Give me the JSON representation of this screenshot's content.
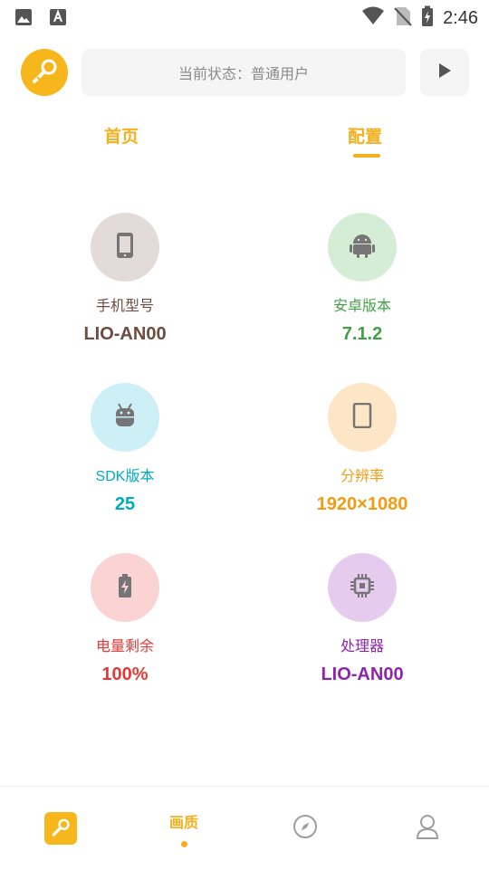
{
  "statusbar": {
    "time": "2:46",
    "icons": [
      "image-icon",
      "font-icon",
      "wifi-icon",
      "no-sim-icon",
      "battery-charging-icon"
    ]
  },
  "header": {
    "status_text": "当前状态：普通用户"
  },
  "tabs": [
    {
      "label": "首页",
      "active": false
    },
    {
      "label": "配置",
      "active": true
    }
  ],
  "info_cards": [
    {
      "label": "手机型号",
      "value": "LIO-AN00",
      "icon": "phone-icon",
      "color": "#6d4c41",
      "bg": "#e3dbd8"
    },
    {
      "label": "安卓版本",
      "value": "7.1.2",
      "icon": "android-icon",
      "color": "#43a047",
      "bg": "#d5ecd5"
    },
    {
      "label": "SDK版本",
      "value": "25",
      "icon": "android-head-icon",
      "color": "#00acc1",
      "bg": "#cdeff6"
    },
    {
      "label": "分辨率",
      "value": "1920×1080",
      "icon": "tablet-icon",
      "color": "#f39c12",
      "bg": "#fde6c6"
    },
    {
      "label": "电量剩余",
      "value": "100%",
      "icon": "battery-icon",
      "color": "#e53935",
      "bg": "#fbd3d3"
    },
    {
      "label": "处理器",
      "value": "LIO-AN00",
      "icon": "cpu-icon",
      "color": "#8e24aa",
      "bg": "#e5cbee"
    }
  ],
  "bottom_nav": [
    {
      "icon": "app-logo-icon",
      "label": ""
    },
    {
      "icon": "",
      "label": "画质",
      "active": true
    },
    {
      "icon": "compass-icon",
      "label": ""
    },
    {
      "icon": "user-icon",
      "label": ""
    }
  ],
  "colors": {
    "accent": "#f4b01d",
    "icon_gray": "#757575"
  }
}
